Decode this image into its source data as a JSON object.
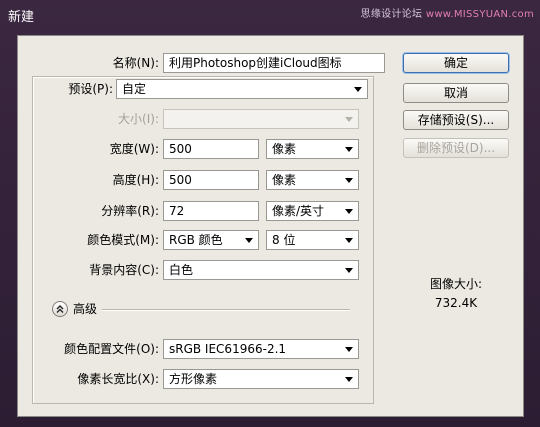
{
  "window": {
    "title": "新建"
  },
  "watermark": {
    "site": "思缘设计论坛",
    "url": "www.MISSYUAN.com"
  },
  "form": {
    "name": {
      "label": "名称(N):",
      "value": "利用Photoshop创建iCloud图标"
    },
    "preset": {
      "label": "预设(P):",
      "value": "自定"
    },
    "size": {
      "label": "大小(I):",
      "value": ""
    },
    "width": {
      "label": "宽度(W):",
      "value": "500",
      "unit": "像素"
    },
    "height": {
      "label": "高度(H):",
      "value": "500",
      "unit": "像素"
    },
    "resolution": {
      "label": "分辨率(R):",
      "value": "72",
      "unit": "像素/英寸"
    },
    "color_mode": {
      "label": "颜色模式(M):",
      "value": "RGB 颜色",
      "depth": "8 位"
    },
    "background": {
      "label": "背景内容(C):",
      "value": "白色"
    },
    "advanced": {
      "label": "高级"
    },
    "color_profile": {
      "label": "颜色配置文件(O):",
      "value": "sRGB IEC61966-2.1"
    },
    "pixel_aspect": {
      "label": "像素长宽比(X):",
      "value": "方形像素"
    }
  },
  "buttons": {
    "ok": "确定",
    "cancel": "取消",
    "save_preset": "存储预设(S)...",
    "delete_preset": "删除预设(D)..."
  },
  "image_size": {
    "label": "图像大小:",
    "value": "732.4K"
  }
}
